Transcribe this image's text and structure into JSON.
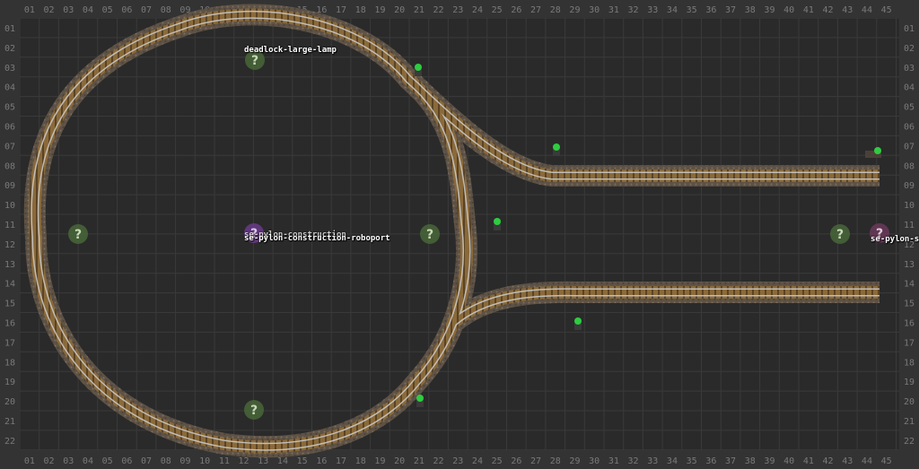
{
  "grid": {
    "columns": [
      "01",
      "02",
      "03",
      "04",
      "05",
      "06",
      "07",
      "08",
      "09",
      "10",
      "11",
      "12",
      "13",
      "14",
      "15",
      "16",
      "17",
      "18",
      "19",
      "20",
      "21",
      "22",
      "23",
      "24",
      "25",
      "26",
      "27",
      "28",
      "29",
      "30",
      "31",
      "32",
      "33",
      "34",
      "35",
      "36",
      "37",
      "38",
      "39",
      "40",
      "41",
      "42",
      "43",
      "44",
      "45"
    ],
    "rows": [
      "01",
      "02",
      "03",
      "04",
      "05",
      "06",
      "07",
      "08",
      "09",
      "10",
      "11",
      "12",
      "13",
      "14",
      "15",
      "16",
      "17",
      "18",
      "19",
      "20",
      "21",
      "22"
    ]
  },
  "entity_labels": {
    "lamp": "deadlock-large-lamp",
    "pylon_center": "se-pylon-construction",
    "pylon_overlap": "se-pylon-construction-roboport",
    "pylon_right": "se-pylon-s"
  },
  "icons": {
    "unknown": "question-mark-icon",
    "signal": "rail-signal-icon"
  },
  "colors": {
    "background": "#2a2a2a",
    "grid_line": "#3a3a3a",
    "header": "#333333",
    "header_text": "#7a7a7a",
    "ballast": "#6a5c4c",
    "rail_wood": "#8a6a3a",
    "rail_steel": "#b8b8b8",
    "signal_light": "#2ecc40",
    "unknown_badge": "#4a6a3a",
    "purple_badge": "#6a3a8a"
  }
}
